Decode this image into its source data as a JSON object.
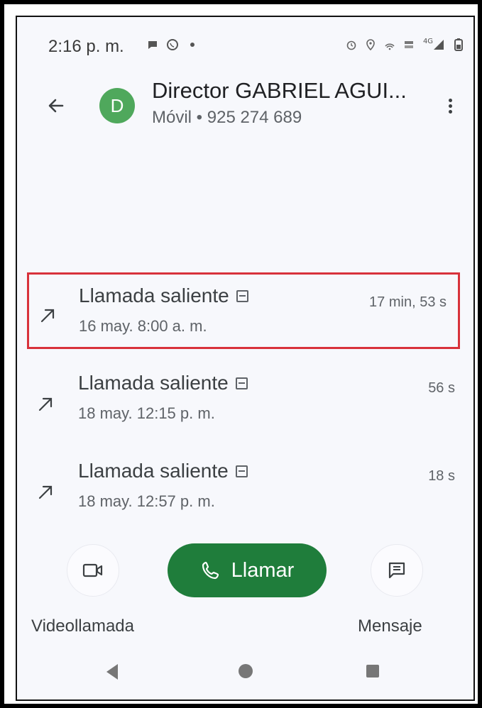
{
  "status_bar": {
    "time": "2:16 p. m.",
    "left_icons": [
      "chat-bubble-icon",
      "whatsapp-icon",
      "dot-icon"
    ],
    "right_icons": [
      "alarm-icon",
      "location-icon",
      "wifi-calling-icon",
      "volte-icon",
      "signal-4g-icon",
      "battery-icon"
    ],
    "network_label": "4G"
  },
  "header": {
    "avatar_letter": "D",
    "contact_name": "Director GABRIEL AGUI...",
    "contact_sub": "Móvil • 925 274 689"
  },
  "calls": [
    {
      "type": "Llamada saliente",
      "date": "16 may. 8:00 a. m.",
      "duration": "17 min, 53 s",
      "highlighted": true
    },
    {
      "type": "Llamada saliente",
      "date": "18 may. 12:15 p. m.",
      "duration": "56 s",
      "highlighted": false
    },
    {
      "type": "Llamada saliente",
      "date": "18 may. 12:57 p. m.",
      "duration": "18 s",
      "highlighted": false
    }
  ],
  "actions": {
    "video_label": "Videollamada",
    "call_label": "Llamar",
    "message_label": "Mensaje"
  },
  "colors": {
    "avatar": "#4fa85c",
    "call_button": "#1f7d3b",
    "highlight_border": "#d8323b"
  }
}
